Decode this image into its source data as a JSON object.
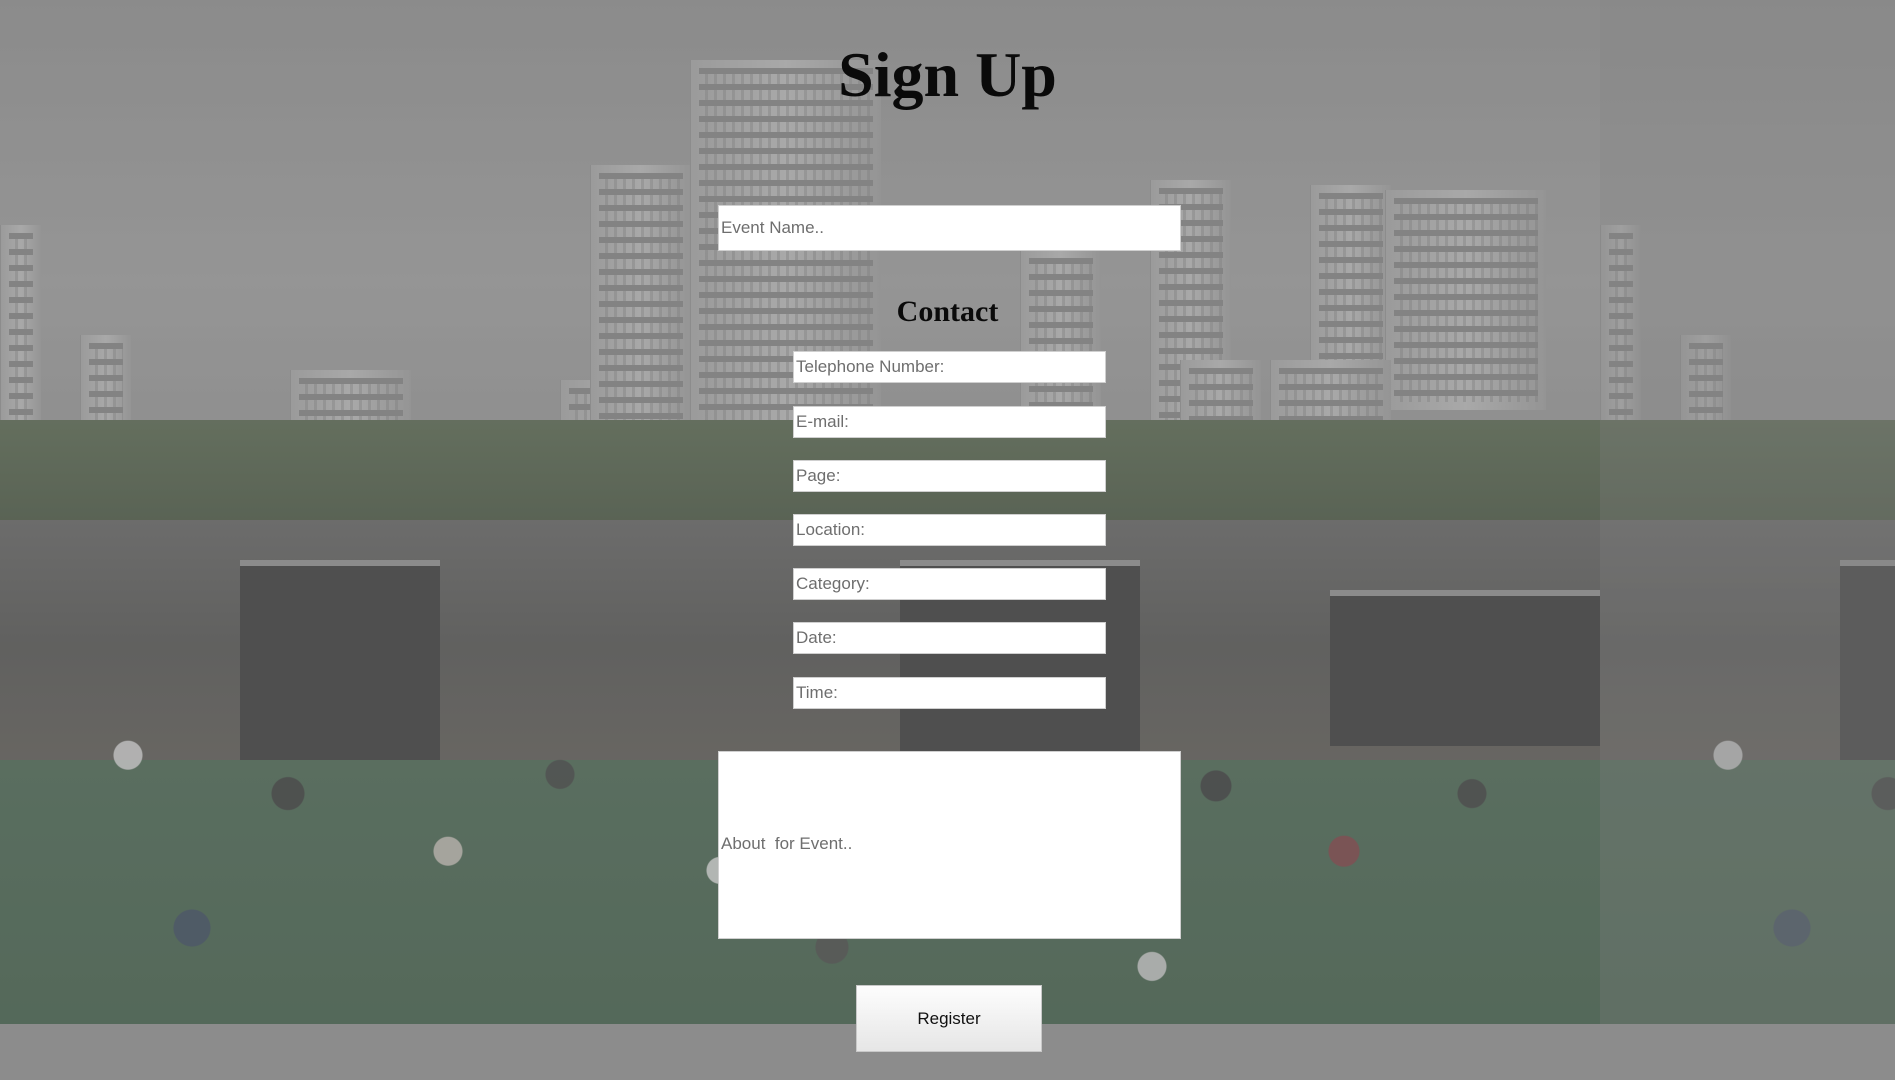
{
  "page": {
    "title": "Sign Up",
    "contact_heading": "Contact"
  },
  "form": {
    "event_name_placeholder": "Event Name..",
    "contact_fields": {
      "telephone_placeholder": "Telephone Number:",
      "email_placeholder": "E-mail:",
      "page_placeholder": "Page:",
      "location_placeholder": "Location:",
      "category_placeholder": "Category:",
      "date_placeholder": "Date:",
      "time_placeholder": "Time:"
    },
    "about_placeholder": "About  for Event..",
    "register_label": "Register"
  },
  "colors": {
    "overlay": "#8a8a8a",
    "heading_text": "#0a0a0a",
    "input_background": "#ffffff",
    "placeholder_text": "#6e6e6e"
  }
}
